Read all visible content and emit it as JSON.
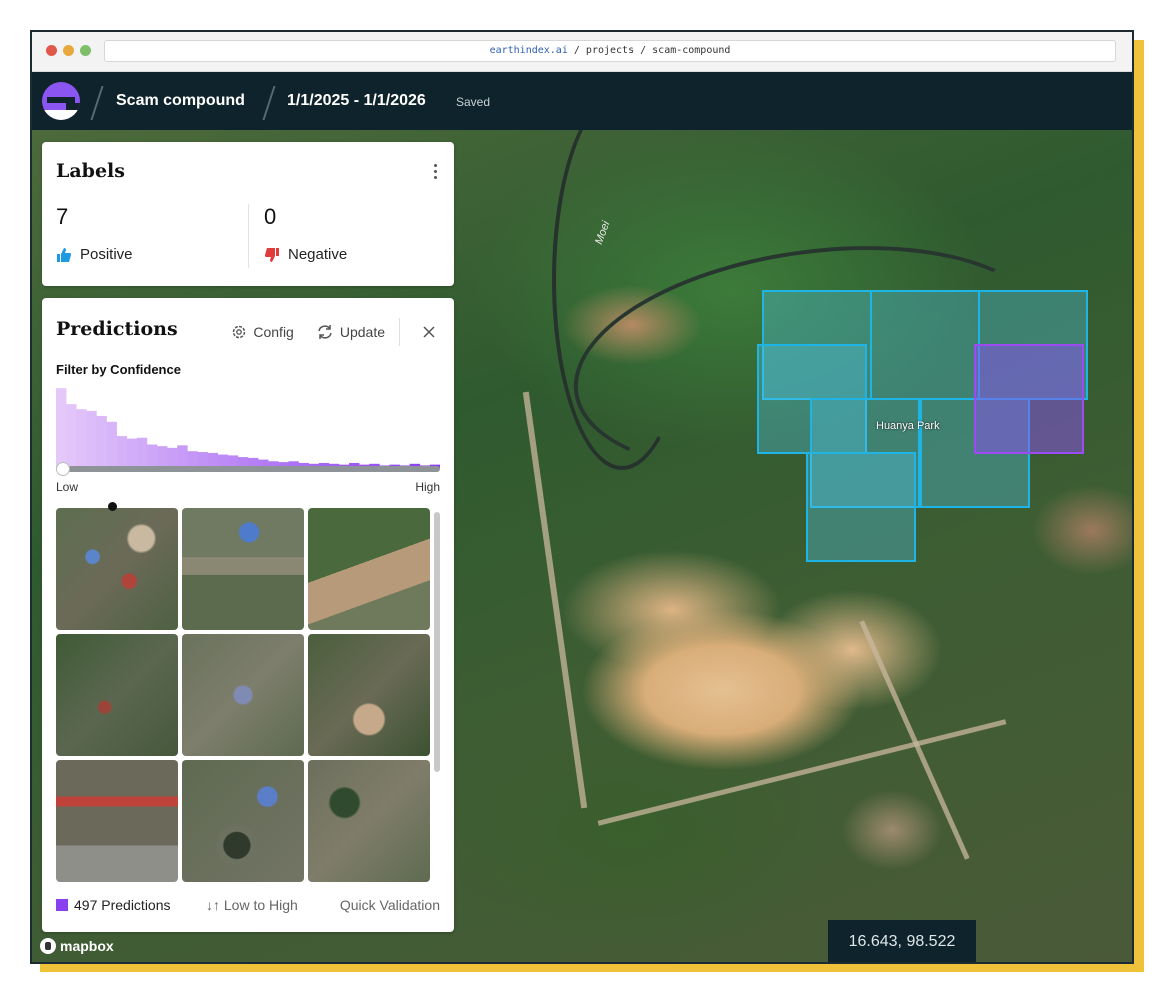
{
  "browser": {
    "url_host": "earthindex.ai",
    "url_path": " / projects / scam-compound"
  },
  "header": {
    "project_title": "Scam compound",
    "date_range": "1/1/2025 - 1/1/2026",
    "save_status": "Saved"
  },
  "labels": {
    "title": "Labels",
    "positive_count": "7",
    "positive_label": "Positive",
    "negative_count": "0",
    "negative_label": "Negative"
  },
  "predictions": {
    "title": "Predictions",
    "config_label": "Config",
    "update_label": "Update",
    "filter_label": "Filter by Confidence",
    "range_low": "Low",
    "range_high": "High",
    "histogram_levels": [
      0.95,
      0.76,
      0.7,
      0.68,
      0.62,
      0.55,
      0.38,
      0.35,
      0.36,
      0.28,
      0.26,
      0.24,
      0.27,
      0.2,
      0.19,
      0.18,
      0.16,
      0.15,
      0.13,
      0.12,
      0.1,
      0.08,
      0.07,
      0.08,
      0.06,
      0.05,
      0.06,
      0.05,
      0.04,
      0.06,
      0.04,
      0.05,
      0.03,
      0.04,
      0.03,
      0.05,
      0.03,
      0.04
    ],
    "count_label": "497 Predictions",
    "sort_label": "Low to High",
    "quick_validation_label": "Quick Validation"
  },
  "map": {
    "place_label": "Huanya Park",
    "river_label": "Moei",
    "coordinates": "16.643, 98.522",
    "attribution": "mapbox"
  },
  "colors": {
    "header_bg": "#0e232b",
    "accent_purple": "#8a3ff0",
    "positive_blue": "#1e9be0",
    "negative_red": "#e03c3c",
    "prediction_box_cyan": "#1fb4e6",
    "frame_yellow": "#f0c23a"
  }
}
